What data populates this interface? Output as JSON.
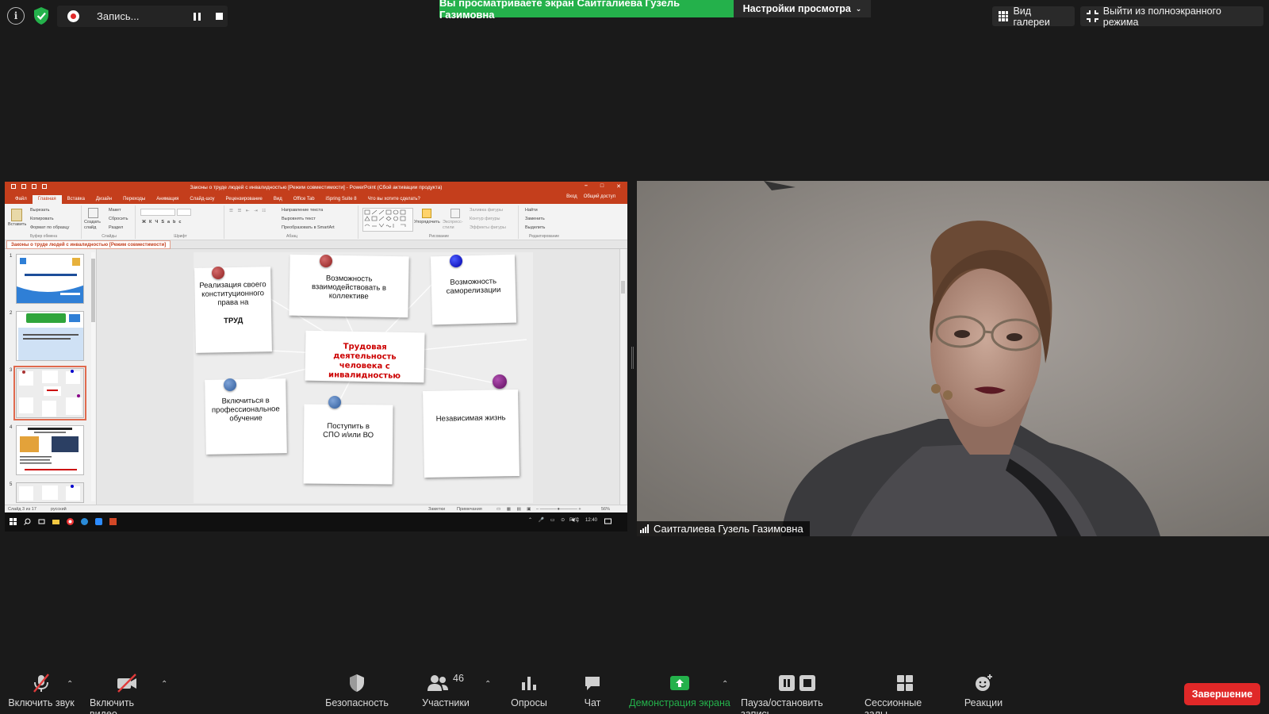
{
  "topbar": {
    "recording_label": "Запись...",
    "share_banner": "Вы просматриваете экран Саитгалиева Гузель Газимовна",
    "view_options": "Настройки просмотра",
    "gallery_view": "Вид галереи",
    "exit_fullscreen": "Выйти из полноэкранного режима"
  },
  "ppt": {
    "window_title": "Законы о труде людей с инвалидностью [Режим совместимости] - PowerPoint (Сбой активации продукта)",
    "tabs": [
      "Файл",
      "Главная",
      "Вставка",
      "Дизайн",
      "Переходы",
      "Анимация",
      "Слайд-шоу",
      "Рецензирование",
      "Вид",
      "Office Tab",
      "iSpring Suite 8",
      "Что вы хотите сделать?"
    ],
    "tabs_right": [
      "Вход",
      "Общий доступ"
    ],
    "ribbon": {
      "paste": "Вставить",
      "cut": "Вырезать",
      "copy": "Копировать",
      "format_painter": "Формат по образцу",
      "clipboard": "Буфер обмена",
      "new_slide": "Создать слайд",
      "layout": "Макет",
      "reset": "Сбросить",
      "section": "Раздел",
      "slides": "Слайды",
      "font": "Шрифт",
      "text_direction": "Направление текста",
      "align_text": "Выровнять текст",
      "smartart": "Преобразовать в SmartArt",
      "paragraph": "Абзац",
      "arrange": "Упорядочить",
      "quick_styles": "Экспресс-стили",
      "shape_fill": "Заливка фигуры",
      "shape_outline": "Контур фигуры",
      "shape_effects": "Эффекты фигуры",
      "drawing": "Рисование",
      "find": "Найти",
      "replace": "Заменить",
      "select": "Выделить",
      "editing": "Редактирование"
    },
    "doc_tab": "Законы о  труде людей с инвалидностью [Режим совместимости]",
    "thumb_numbers": [
      "1",
      "2",
      "3",
      "4",
      "5"
    ],
    "slide": {
      "note1_text": "Реализация своего конституционного права на",
      "note1_bold": "ТРУД",
      "note2": "Возможность взаимодействовать в коллективе",
      "note3": "Возможность саморелизации",
      "center": "Трудовая деятельность человека с инвалидностью",
      "note4": "Включиться в профессиональное обучение",
      "note5": "Поступить в СПО и/или ВО",
      "note6": "Независимая жизнь"
    },
    "status": {
      "slide_of": "Слайд 3 из 17",
      "language": "русский",
      "notes": "Заметки",
      "comments": "Примечания",
      "zoom": "56%"
    },
    "taskbar": {
      "lang": "РУС",
      "time": "12:40"
    }
  },
  "video": {
    "participant_name": "Саитгалиева Гузель Газимовна"
  },
  "toolbar": {
    "mic": "Включить звук",
    "video": "Включить видео",
    "security": "Безопасность",
    "participants": "Участники",
    "participants_count": "46",
    "polls": "Опросы",
    "chat": "Чат",
    "share": "Демонстрация экрана",
    "pause_record": "Пауза/остановить запись",
    "breakout": "Сессионные залы",
    "reactions": "Реакции",
    "end": "Завершение"
  },
  "colors": {
    "zoom_green": "#24b14b",
    "end_red": "#e02828",
    "ppt_orange": "#c43e1c",
    "slide_title_red": "#cc0000"
  }
}
